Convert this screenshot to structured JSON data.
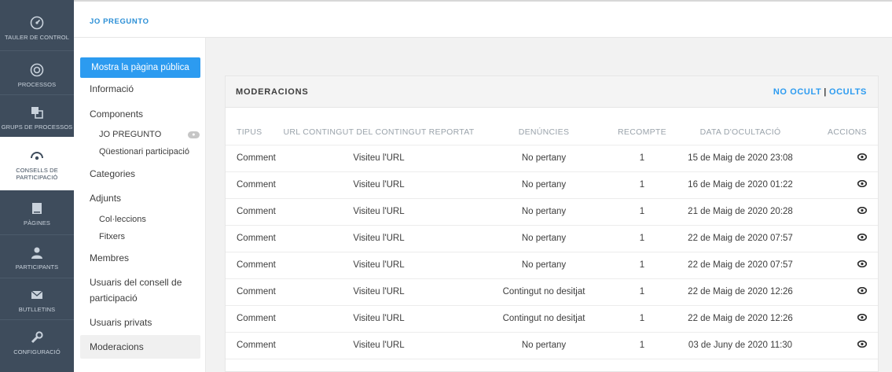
{
  "sidebar": {
    "items": [
      {
        "label": "TAULER DE CONTROL",
        "icon": "dashboard-icon"
      },
      {
        "label": "PROCESSOS",
        "icon": "processes-icon"
      },
      {
        "label": "GRUPS DE PROCESSOS",
        "icon": "process-groups-icon"
      },
      {
        "label": "CONSELLS DE PARTICIPACIÓ",
        "icon": "assemblies-icon"
      },
      {
        "label": "PÀGINES",
        "icon": "pages-icon"
      },
      {
        "label": "PARTICIPANTS",
        "icon": "participants-icon"
      },
      {
        "label": "BUTLLETINS",
        "icon": "newsletter-icon"
      },
      {
        "label": "CONFIGURACIÓ",
        "icon": "settings-icon"
      }
    ]
  },
  "header": {
    "title": "JO PREGUNTO"
  },
  "subnav": {
    "public_button": "Mostra la pàgina pública",
    "informacio": "Informació",
    "components": "Components",
    "component_1": "JO PREGUNTO",
    "component_2": "Qüestionari participació",
    "categories": "Categories",
    "adjunts": "Adjunts",
    "colleccions": "Col·leccions",
    "fitxers": "Fitxers",
    "membres": "Membres",
    "usuaris_consell_1": "Usuaris del consell de",
    "usuaris_consell_2": "participació",
    "usuaris_privats": "Usuaris privats",
    "moderacions": "Moderacions"
  },
  "card": {
    "title": "MODERACIONS",
    "filter_not_hidden": "NO OCULT",
    "filter_sep": "|",
    "filter_hidden": "OCULTS",
    "columns": [
      "TIPUS",
      "URL CONTINGUT DEL CONTINGUT REPORTAT",
      "DENÚNCIES",
      "RECOMPTE",
      "DATA D'OCULTACIÓ",
      "ACCIONS"
    ],
    "rows": [
      {
        "type": "Comment",
        "url": "Visiteu l'URL",
        "reason": "No pertany",
        "count": "1",
        "date": "15 de Maig de 2020 23:08"
      },
      {
        "type": "Comment",
        "url": "Visiteu l'URL",
        "reason": "No pertany",
        "count": "1",
        "date": "16 de Maig de 2020 01:22"
      },
      {
        "type": "Comment",
        "url": "Visiteu l'URL",
        "reason": "No pertany",
        "count": "1",
        "date": "21 de Maig de 2020 20:28"
      },
      {
        "type": "Comment",
        "url": "Visiteu l'URL",
        "reason": "No pertany",
        "count": "1",
        "date": "22 de Maig de 2020 07:57"
      },
      {
        "type": "Comment",
        "url": "Visiteu l'URL",
        "reason": "No pertany",
        "count": "1",
        "date": "22 de Maig de 2020 07:57"
      },
      {
        "type": "Comment",
        "url": "Visiteu l'URL",
        "reason": "Contingut no desitjat",
        "count": "1",
        "date": "22 de Maig de 2020 12:26"
      },
      {
        "type": "Comment",
        "url": "Visiteu l'URL",
        "reason": "Contingut no desitjat",
        "count": "1",
        "date": "22 de Maig de 2020 12:26"
      },
      {
        "type": "Comment",
        "url": "Visiteu l'URL",
        "reason": "No pertany",
        "count": "1",
        "date": "03 de Juny de 2020 11:30"
      }
    ]
  },
  "colors": {
    "accent": "#2c9bf0",
    "sidebar": "#3e4c5c"
  }
}
